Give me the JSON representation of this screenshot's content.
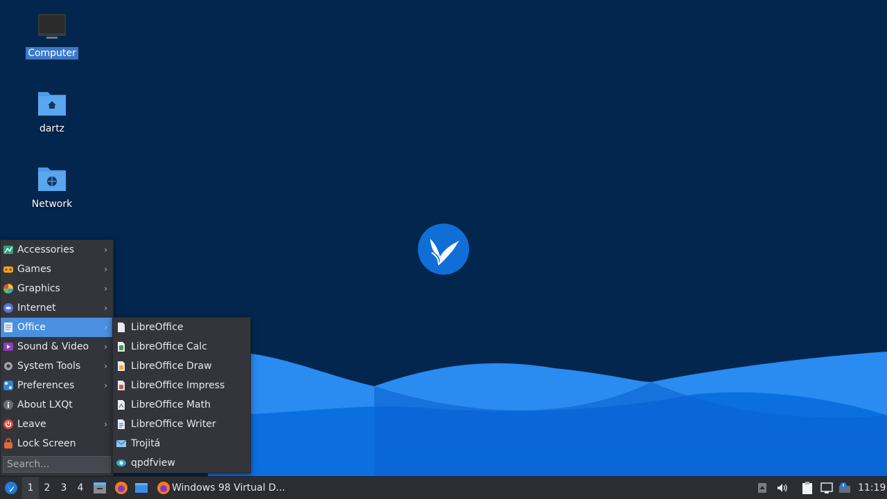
{
  "desktop": {
    "icons": [
      {
        "label": "Computer",
        "icon": "computer-icon",
        "selected": true
      },
      {
        "label": "dartz",
        "icon": "home-folder-icon"
      },
      {
        "label": "Network",
        "icon": "network-folder-icon"
      }
    ]
  },
  "start_menu": {
    "items": [
      {
        "label": "Accessories",
        "icon": "accessories-icon",
        "submenu": true
      },
      {
        "label": "Games",
        "icon": "games-icon",
        "submenu": true
      },
      {
        "label": "Graphics",
        "icon": "graphics-icon",
        "submenu": true
      },
      {
        "label": "Internet",
        "icon": "internet-icon",
        "submenu": true
      },
      {
        "label": "Office",
        "icon": "office-icon",
        "submenu": true,
        "active": true
      },
      {
        "label": "Sound & Video",
        "icon": "sound-video-icon",
        "submenu": true
      },
      {
        "label": "System Tools",
        "icon": "system-tools-icon",
        "submenu": true
      },
      {
        "label": "Preferences",
        "icon": "preferences-icon",
        "submenu": true
      },
      {
        "label": "About LXQt",
        "icon": "info-icon",
        "submenu": false
      },
      {
        "label": "Leave",
        "icon": "power-icon",
        "submenu": true
      },
      {
        "label": "Lock Screen",
        "icon": "lock-icon",
        "submenu": false
      }
    ],
    "search_placeholder": "Search..."
  },
  "office_submenu": {
    "items": [
      {
        "label": "LibreOffice",
        "icon": "libreoffice-icon"
      },
      {
        "label": "LibreOffice Calc",
        "icon": "libreoffice-calc-icon"
      },
      {
        "label": "LibreOffice Draw",
        "icon": "libreoffice-draw-icon"
      },
      {
        "label": "LibreOffice Impress",
        "icon": "libreoffice-impress-icon"
      },
      {
        "label": "LibreOffice Math",
        "icon": "libreoffice-math-icon"
      },
      {
        "label": "LibreOffice Writer",
        "icon": "libreoffice-writer-icon"
      },
      {
        "label": "Trojitá",
        "icon": "mail-icon"
      },
      {
        "label": "qpdfview",
        "icon": "pdf-viewer-icon"
      }
    ]
  },
  "taskbar": {
    "workspaces": [
      "1",
      "2",
      "3",
      "4"
    ],
    "active_workspace": "1",
    "task_title": "Windows 98 Virtual D...",
    "clock": "11:19"
  },
  "colors": {
    "desktop_bg": "#02264e",
    "menu_bg": "#33353b",
    "menu_active": "#4a8fe0",
    "taskbar_bg": "#2b2d32",
    "wave_light": "#2a8bf0",
    "wave_dark": "#0b6fe0"
  }
}
